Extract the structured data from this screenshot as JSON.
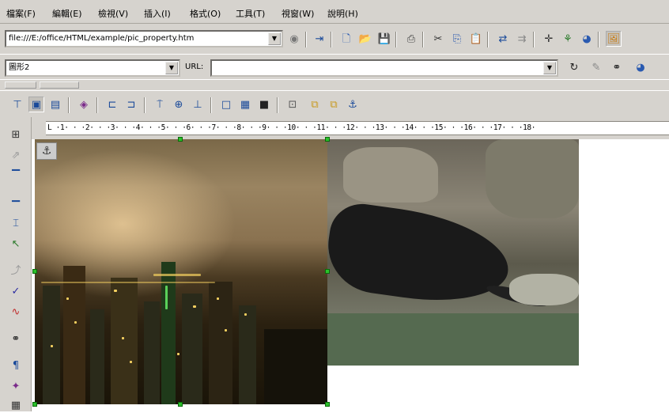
{
  "menu": [
    "檔案(F)",
    "編輯(E)",
    "檢視(V)",
    "插入(I)",
    "格式(O)",
    "工具(T)",
    "視窗(W)",
    "說明(H)"
  ],
  "file_combo": {
    "value": "file:///E:/office/HTML/example/pic_property.htm"
  },
  "name_combo": {
    "value": "圖形2"
  },
  "url_label": "URL:",
  "url_field": {
    "value": ""
  },
  "ruler_text": "L ·1· · ·2· · ·3· · ·4· · ·5· · ·6· · ·7· · ·8· · ·9· · ·10· · ·11· · ·12· · ·13· · ·14· · ·15· · ·16· · ·17· · ·18·",
  "images": [
    {
      "name": "city-night-photo",
      "scene": "夜景"
    },
    {
      "name": "seal-rock-photo",
      "scene": "海獅"
    }
  ]
}
